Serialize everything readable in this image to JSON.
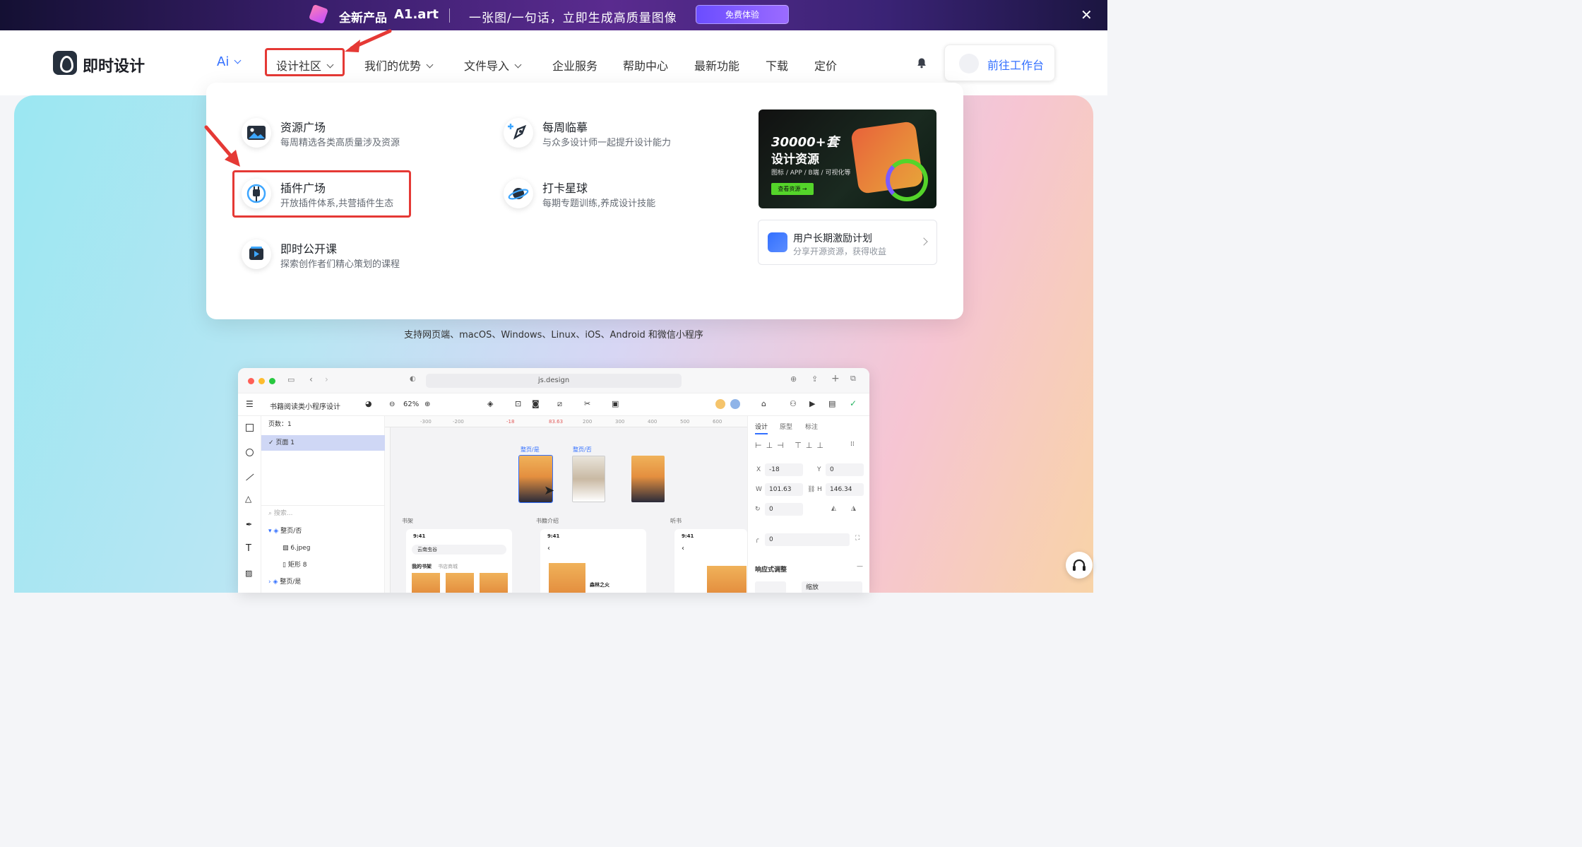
{
  "promo_banner": {
    "new_product": "全新产品",
    "product_name": "A1.art",
    "slogan": "一张图/一句话，立即生成高质量图像",
    "cta": "免费体验"
  },
  "header": {
    "brand": "即时设计",
    "nav": [
      "Ai",
      "设计社区",
      "我们的优势",
      "文件导入",
      "企业服务",
      "帮助中心",
      "最新功能",
      "下载",
      "定价"
    ],
    "workbench": "前往工作台"
  },
  "dropdown": {
    "items": [
      {
        "title": "资源广场",
        "desc": "每周精选各类高质量涉及资源"
      },
      {
        "title": "插件广场",
        "desc": "开放插件体系,共营插件生态"
      },
      {
        "title": "即时公开课",
        "desc": "探索创作者们精心策划的课程"
      },
      {
        "title": "每周临摹",
        "desc": "与众多设计师一起提升设计能力"
      },
      {
        "title": "打卡星球",
        "desc": "每期专题训练,养成设计技能"
      }
    ],
    "promo_card": {
      "headline": "30000+套",
      "subline": "设计资源",
      "tags": "图标 / APP / B端 / 可视化等",
      "button": "查看资源 →"
    },
    "incentive": {
      "title": "用户长期激励计划",
      "desc": "分享开源资源，获得收益"
    }
  },
  "hero": {
    "support_text": "支持网页端、macOS、Windows、Linux、iOS、Android 和微信小程序"
  },
  "mock_editor": {
    "url": "js.design",
    "file_name": "书籍阅读类小程序设计",
    "zoom": "62%",
    "pages_label": "页数：1",
    "page_1": "页面 1",
    "search_placeholder": "搜索...",
    "layers": [
      "整页/否",
      "6.jpeg",
      "矩形 8",
      "整页/是"
    ],
    "ruler_ticks": [
      "-300",
      "-200",
      "-18",
      "83.63",
      "200",
      "300",
      "400",
      "500",
      "600"
    ],
    "frame_labels": [
      "整页/是",
      "整页/否"
    ],
    "sections": [
      "书架",
      "书籍介绍",
      "听书"
    ],
    "time": "9:41",
    "shelf_search": "云南虫谷",
    "shelf_tabs": [
      "我的书架",
      "书店商城"
    ],
    "book_title": "森林之火",
    "props_tabs": [
      "设计",
      "原型",
      "标注"
    ],
    "props": {
      "x": "-18",
      "y": "0",
      "w": "101.63",
      "h": "146.34",
      "rot": "0",
      "radius": "0"
    },
    "responsive": "响应式调整",
    "scale": "缩放"
  }
}
